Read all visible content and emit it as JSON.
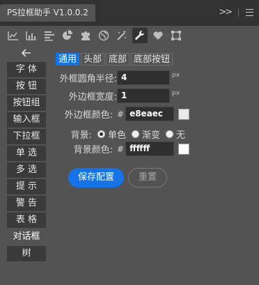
{
  "window": {
    "tab_title": "PS拉框助手 V1.0.0.2"
  },
  "toolbar": {
    "icons": [
      "chart-line-icon",
      "chart-bar-icon",
      "align-left-icon",
      "pie-chart-icon",
      "puzzle-icon",
      "globe-icon",
      "magic-wand-icon",
      "wrench-icon",
      "heart-icon",
      "vector-shape-icon"
    ],
    "active_index": 7
  },
  "sidebar": {
    "items": [
      "字 体",
      "按 钮",
      "按钮组",
      "输入框",
      "下拉框",
      "单 选",
      "多 选",
      "提 示",
      "警 告",
      "表 格",
      "对话框",
      "树"
    ],
    "active_index": 10
  },
  "tabs": [
    "通用",
    "头部",
    "底部",
    "底部按钮"
  ],
  "form": {
    "radius": {
      "label": "外框圆角半径:",
      "value": "4",
      "unit": "px"
    },
    "border_width": {
      "label": "外边框宽度:",
      "value": "1",
      "unit": "px"
    },
    "border_color": {
      "label": "外边框颜色:",
      "hash": "#",
      "value": "e8eaec",
      "swatch": "#e8eaec"
    },
    "background": {
      "label": "背景:",
      "options": [
        "单色",
        "渐变",
        "无"
      ],
      "selected": 0
    },
    "bg_color": {
      "label": "背景颜色:",
      "hash": "#",
      "value": "ffffff",
      "swatch": "#ffffff"
    }
  },
  "buttons": {
    "save": "保存配置",
    "reset": "重置"
  },
  "colors": {
    "accent": "#1473e6",
    "panel": "#535353",
    "dark": "#323232"
  }
}
